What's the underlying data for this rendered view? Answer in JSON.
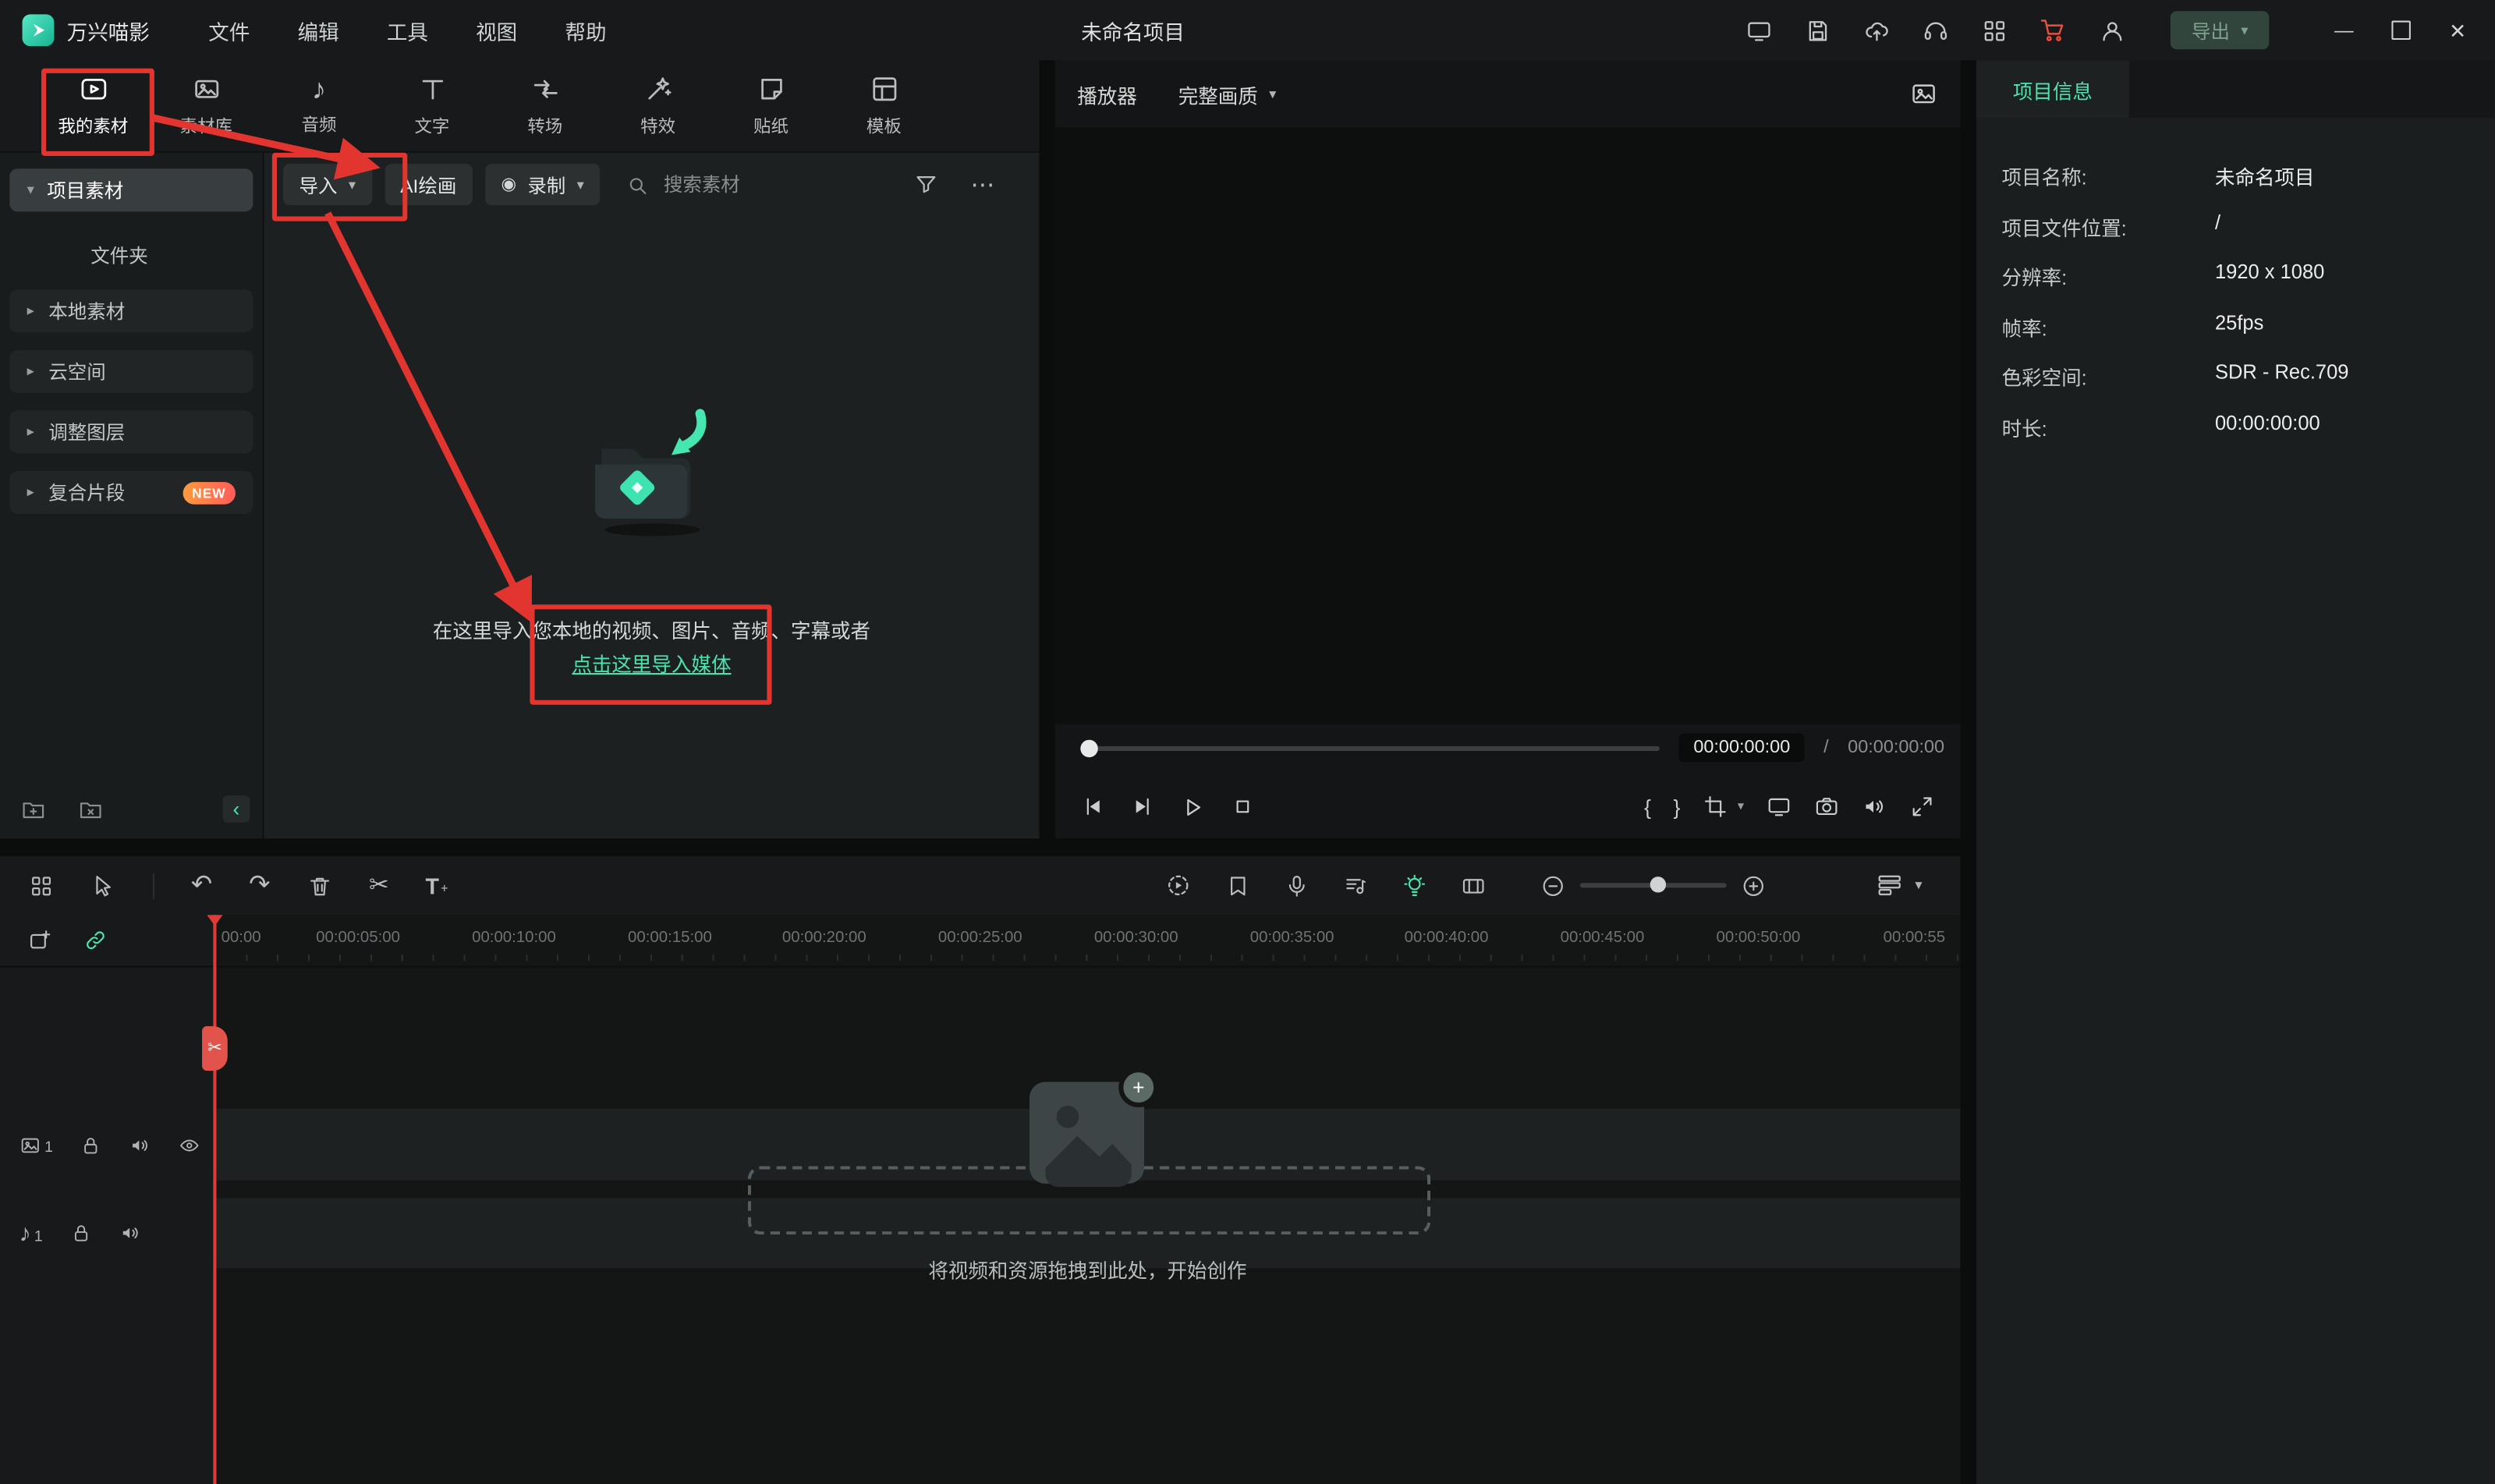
{
  "titlebar": {
    "app_name": "万兴喵影",
    "menus": {
      "file": "文件",
      "edit": "编辑",
      "tools": "工具",
      "view": "视图",
      "help": "帮助"
    },
    "project_title": "未命名项目",
    "export_label": "导出"
  },
  "media_tabs": {
    "my_media": "我的素材",
    "stock": "素材库",
    "audio": "音频",
    "text": "文字",
    "transition": "转场",
    "effects": "特效",
    "stickers": "贴纸",
    "templates": "模板"
  },
  "sidebar": {
    "project_media": "项目素材",
    "folder": "文件夹",
    "local_media": "本地素材",
    "cloud": "云空间",
    "adjust_layer": "调整图层",
    "compound_clip": "复合片段",
    "new_badge": "NEW"
  },
  "media_toolbar": {
    "import": "导入",
    "ai_paint": "AI绘画",
    "record": "录制",
    "search_placeholder": "搜索素材"
  },
  "empty_state": {
    "line1": "在这里导入您本地的视频、图片、音频、字幕或者",
    "link": "点击这里导入媒体"
  },
  "player": {
    "label": "播放器",
    "quality": "完整画质",
    "current_time": "00:00:00:00",
    "divider": "/",
    "total_time": "00:00:00:00"
  },
  "project_info": {
    "tab": "项目信息",
    "rows": [
      {
        "label": "项目名称:",
        "value": "未命名项目"
      },
      {
        "label": "项目文件位置:",
        "value": "/"
      },
      {
        "label": "分辨率:",
        "value": "1920 x 1080"
      },
      {
        "label": "帧率:",
        "value": "25fps"
      },
      {
        "label": "色彩空间:",
        "value": "SDR - Rec.709"
      },
      {
        "label": "时长:",
        "value": "00:00:00:00"
      }
    ]
  },
  "timeline": {
    "ruler": [
      "00:00",
      "00:00:05:00",
      "00:00:10:00",
      "00:00:15:00",
      "00:00:20:00",
      "00:00:25:00",
      "00:00:30:00",
      "00:00:35:00",
      "00:00:40:00",
      "00:00:45:00",
      "00:00:50:00",
      "00:00:55"
    ],
    "video_track_no": "1",
    "audio_track_no": "1",
    "drop_hint": "将视频和资源拖拽到此处，开始创作"
  },
  "glyphs": {
    "chevron_down": "▾",
    "caret_right": "▸",
    "caret_down": "▾",
    "ellipsis": "⋯",
    "record_dot": "◉",
    "brace_open": "{",
    "brace_close": "}",
    "undo": "↶",
    "redo": "↷",
    "scissors": "✂",
    "note": "♪",
    "collapse": "‹",
    "minimize": "—",
    "close": "✕",
    "text_tool": "T",
    "plus": "+"
  },
  "colors": {
    "accent": "#4be3ae",
    "annotation": "#e23530",
    "badge": "#ff8a3c"
  }
}
